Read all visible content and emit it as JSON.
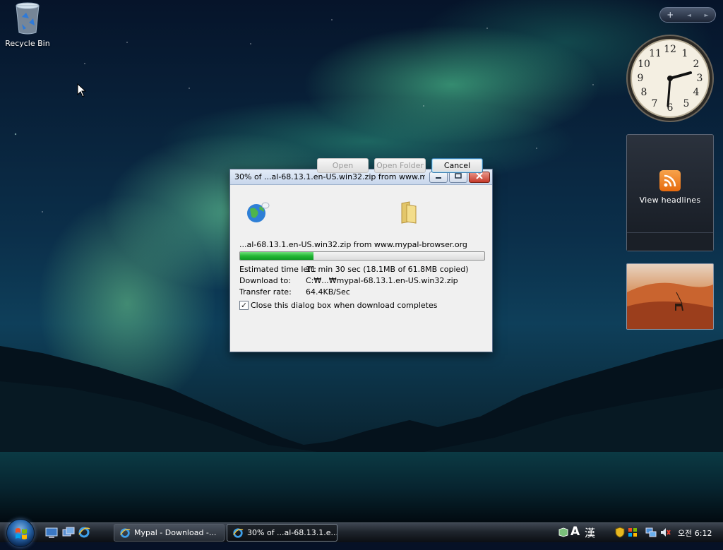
{
  "desktop": {
    "recycle_bin_label": "Recycle Bin"
  },
  "sidebar": {
    "add_label": "+",
    "prev_label": "◄",
    "next_label": "►",
    "feed_label": "View headlines"
  },
  "dialog": {
    "title": "30% of ...al-68.13.1.en-US.win32.zip from www.m...",
    "file_line": "...al-68.13.1.en-US.win32.zip from www.mypal-browser.org",
    "progress": 0.3,
    "time_label": "Estimated time left:",
    "time_value": "11 min 30 sec (18.1MB of 61.8MB copied)",
    "dest_label": "Download to:",
    "dest_value": "C:₩...₩mypal-68.13.1.en-US.win32.zip",
    "rate_label": "Transfer rate:",
    "rate_value": "64.4KB/Sec",
    "close_checkbox_label": "Close this dialog box when download completes",
    "close_checked": true,
    "open_label": "Open",
    "open_folder_label": "Open Folder",
    "cancel_label": "Cancel"
  },
  "taskbar": {
    "tasks": [
      {
        "label": "Mypal - Download -..."
      },
      {
        "label": "30% of ...al-68.13.1.e..."
      }
    ],
    "tray_lang": "A",
    "tray_hanja": "漢",
    "clock": "오전 6:12"
  },
  "icons": {
    "recycle_bin": "recycle-bin-icon",
    "globe": "globe-icon",
    "folder": "folder-icon",
    "rss": "rss-icon",
    "ie": "internet-explorer-icon",
    "network": "network-icon",
    "volume": "volume-muted-icon"
  },
  "colors": {
    "progress": "#23b735",
    "cancel_border": "#3c7fb1"
  }
}
